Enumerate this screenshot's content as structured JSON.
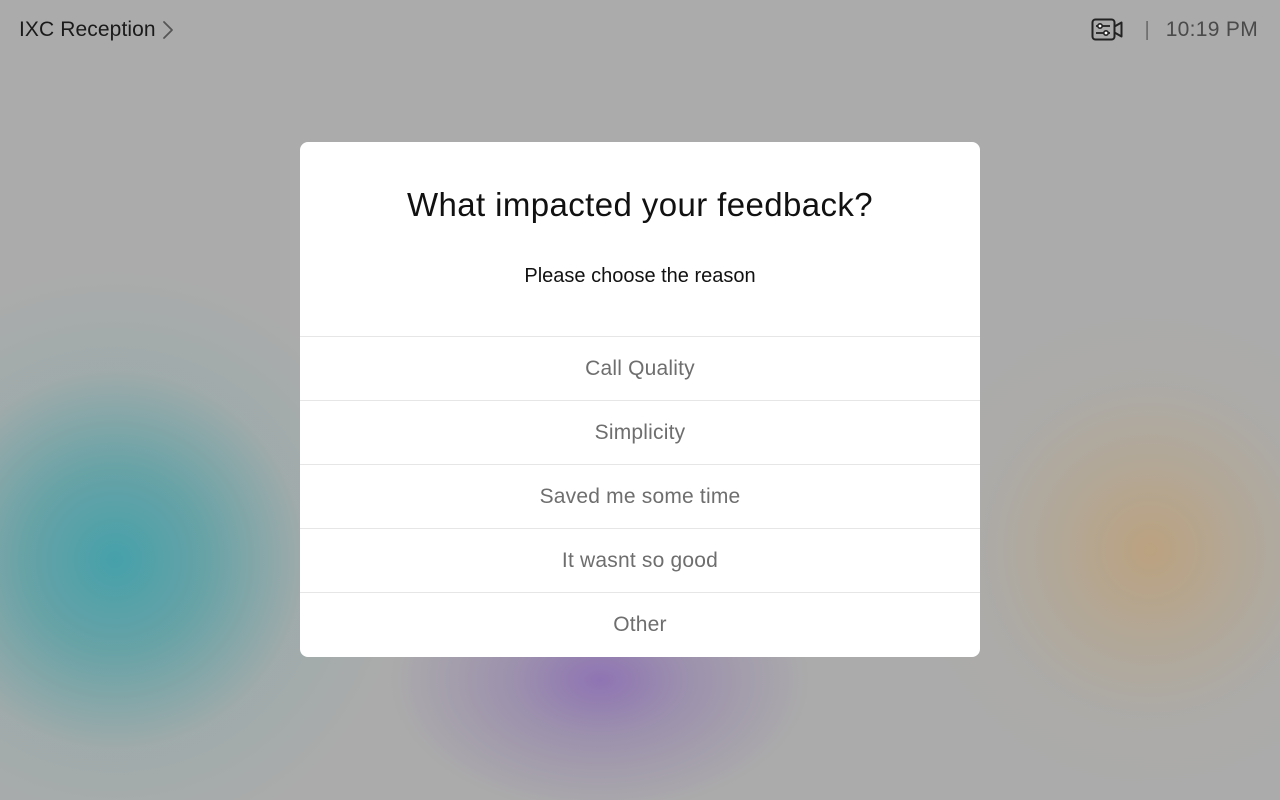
{
  "header": {
    "breadcrumb_label": "IXC Reception",
    "chevron_icon": "chevron-right-icon",
    "camera_icon": "camera-controls-icon",
    "separator": "|",
    "time": "10:19 PM"
  },
  "dialog": {
    "title": "What impacted your feedback?",
    "subtitle": "Please choose the reason",
    "options": [
      {
        "label": "Call Quality"
      },
      {
        "label": "Simplicity"
      },
      {
        "label": "Saved me some time"
      },
      {
        "label": "It wasnt so good"
      },
      {
        "label": "Other"
      }
    ]
  },
  "colors": {
    "background": "#ababab",
    "dialog_background": "#ffffff",
    "option_text": "#6e6e6e",
    "divider": "#e6e6e6"
  }
}
